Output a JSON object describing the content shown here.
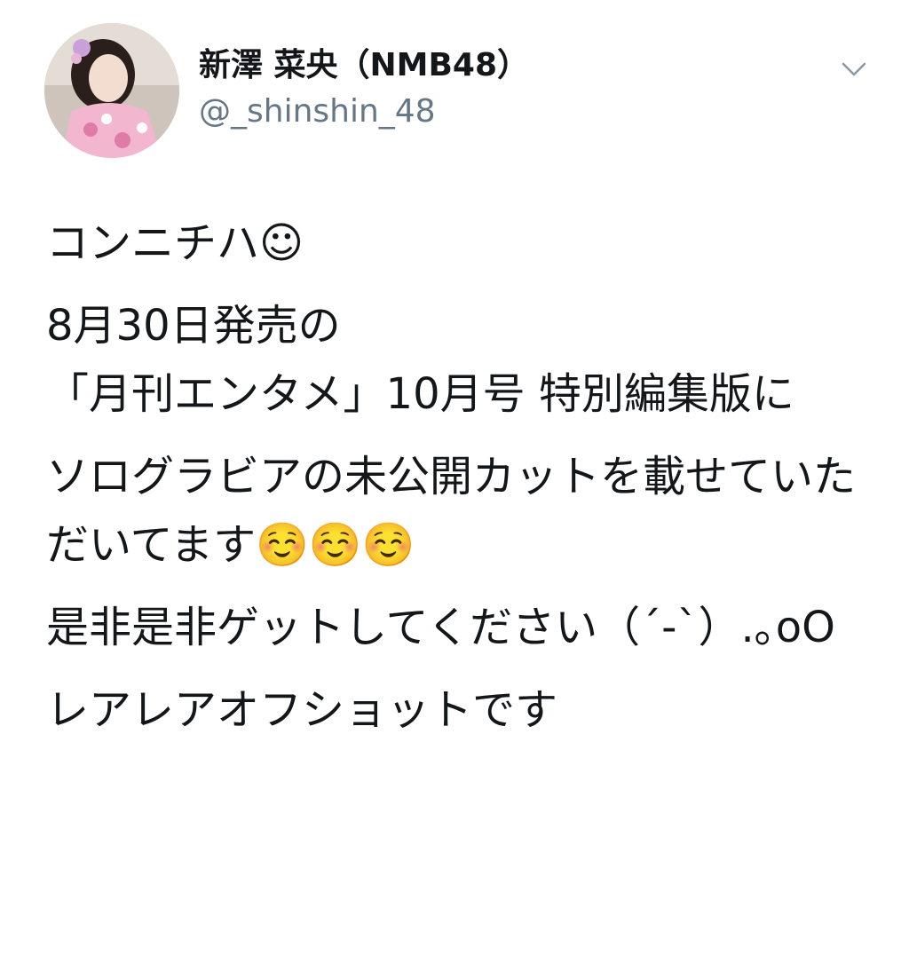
{
  "tweet": {
    "author": {
      "display_name": "新澤 菜央（NMB48）",
      "handle": "@_shinshin_48",
      "avatar_icon": "profile-photo-avatar"
    },
    "menu_icon": "chevron-down-icon",
    "paragraphs": [
      "コンニチハ☺",
      "8月30日発売の\n「月刊エンタメ」10月号 特別編集版に",
      "ソログラビアの未公開カットを載せていただいてます☺️☺️☺️",
      "是非是非ゲットしてください（´-`）.｡oO",
      "レアレアオフショットです"
    ]
  },
  "colors": {
    "name_text": "#14171a",
    "handle_text": "#657786",
    "caret": "#8899a6",
    "background": "#ffffff"
  }
}
